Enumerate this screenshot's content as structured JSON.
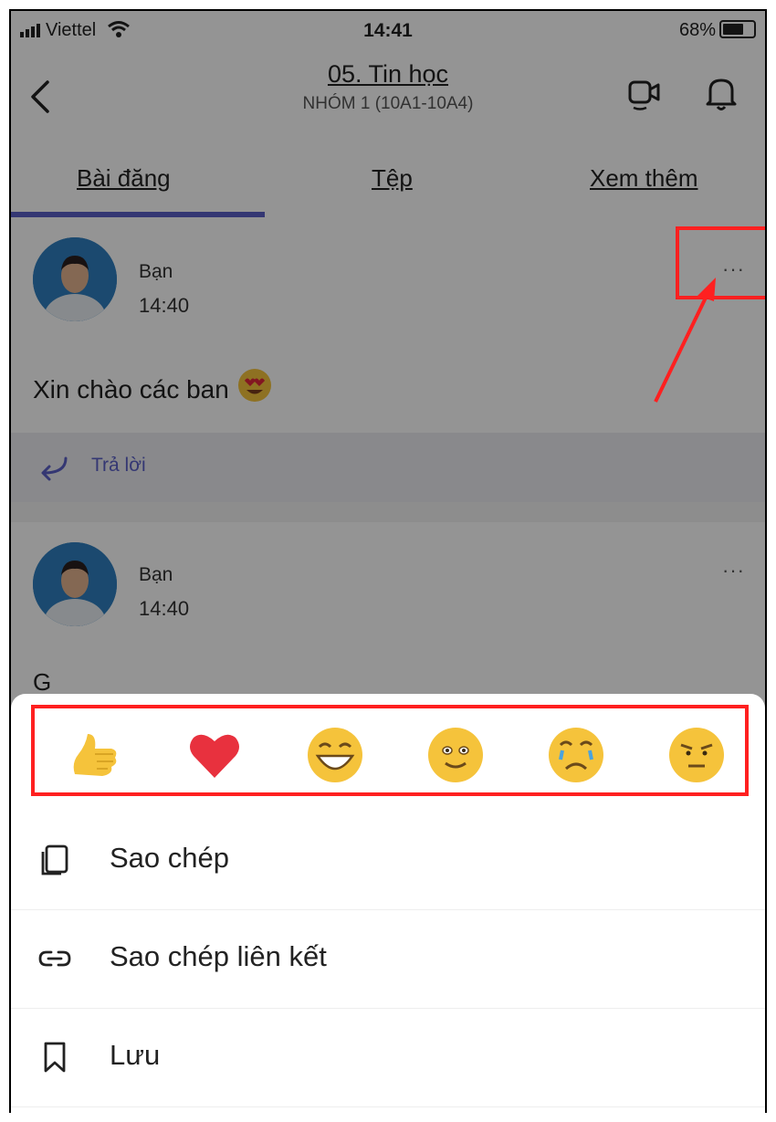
{
  "status_bar": {
    "carrier": "Viettel",
    "time": "14:41",
    "battery": "68%"
  },
  "header": {
    "title": "05. Tin học",
    "subtitle": "NHÓM 1 (10A1-10A4)"
  },
  "tabs": [
    {
      "label": "Bài đăng",
      "active": true
    },
    {
      "label": "Tệp",
      "active": false
    },
    {
      "label": "Xem thêm",
      "active": false
    }
  ],
  "posts": [
    {
      "author": "Bạn",
      "time": "14:40",
      "text": "Xin chào các ban",
      "more": "···",
      "reply_label": "Trả lời"
    },
    {
      "author": "Bạn",
      "time": "14:40",
      "text": "G",
      "more": "···"
    }
  ],
  "reactions": [
    "like-icon",
    "heart-icon",
    "laugh-icon",
    "smile-icon",
    "sad-icon",
    "angry-icon"
  ],
  "menu": [
    {
      "label": "Sao chép",
      "icon": "copy-icon"
    },
    {
      "label": "Sao chép liên kết",
      "icon": "link-icon"
    },
    {
      "label": "Lưu",
      "icon": "bookmark-icon"
    }
  ],
  "colors": {
    "accent": "#5b5fc7",
    "annotation": "#ff2020"
  }
}
